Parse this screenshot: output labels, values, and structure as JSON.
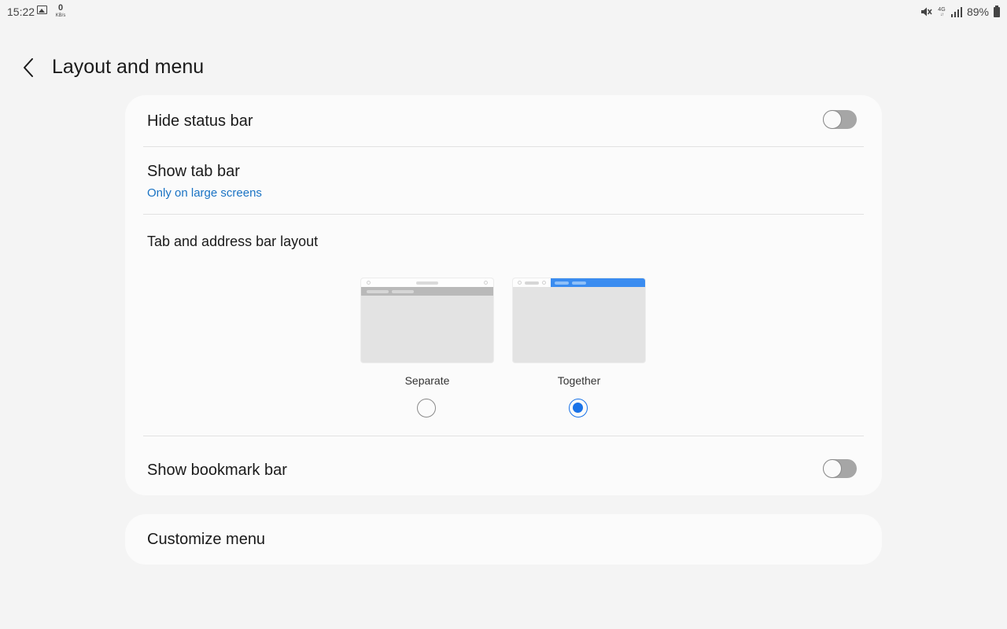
{
  "status_bar": {
    "time": "15:22",
    "data_rate_value": "0",
    "data_rate_unit": "KB/s",
    "network": "4G",
    "network_arrows": "↓↑",
    "battery_percent": "89%",
    "icons": [
      "gallery-icon",
      "mute-icon",
      "signal-icon",
      "battery-icon"
    ]
  },
  "header": {
    "title": "Layout and menu",
    "back_icon": "chevron-left-icon"
  },
  "settings": {
    "hide_status_bar": {
      "label": "Hide status bar",
      "enabled": false
    },
    "show_tab_bar": {
      "label": "Show tab bar",
      "value": "Only on large screens"
    },
    "tab_layout": {
      "label": "Tab and address bar layout",
      "options": [
        {
          "label": "Separate",
          "selected": false
        },
        {
          "label": "Together",
          "selected": true
        }
      ]
    },
    "show_bookmark_bar": {
      "label": "Show bookmark bar",
      "enabled": false
    }
  },
  "customize_menu": {
    "label": "Customize menu"
  },
  "colors": {
    "accent": "#1a73e8",
    "subtitle_blue": "#1a73c4",
    "toggle_off": "#a6a6a6",
    "background": "#f4f4f4",
    "card": "#fbfbfb"
  }
}
